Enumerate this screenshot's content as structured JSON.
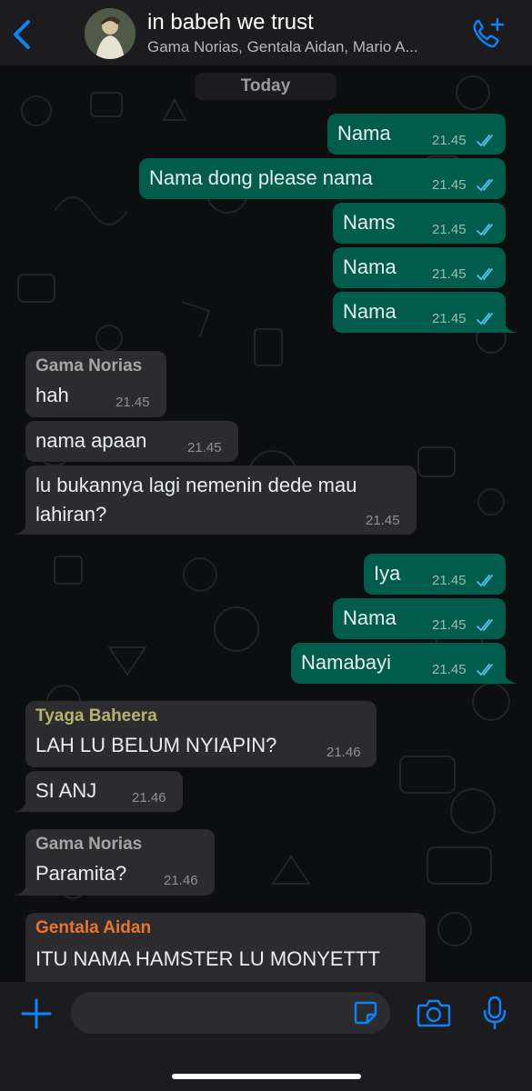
{
  "header": {
    "back_icon": "chevron-left-icon",
    "title": "in babeh we trust",
    "subtitle": "Gama Norias, Gentala Aidan, Mario A...",
    "call_icon": "add-call-icon",
    "accent": "#0a84ff"
  },
  "chat": {
    "date_label": "Today",
    "outgoing_color": "#005c4b",
    "incoming_color": "#2c2c2e",
    "read_tick_color": "#53bdeb",
    "messages": [
      {
        "dir": "out",
        "text": "Nama",
        "time": "21.45",
        "status": "read"
      },
      {
        "dir": "out",
        "text": "Nama dong please nama",
        "time": "21.45",
        "status": "read"
      },
      {
        "dir": "out",
        "text": "Nams",
        "time": "21.45",
        "status": "read"
      },
      {
        "dir": "out",
        "text": "Nama",
        "time": "21.45",
        "status": "read"
      },
      {
        "dir": "out",
        "text": "Nama",
        "time": "21.45",
        "status": "read"
      },
      {
        "dir": "in",
        "sender": "Gama Norias",
        "sender_color": "#a6a6a6",
        "text": "hah",
        "time": "21.45"
      },
      {
        "dir": "in",
        "text": "nama apaan",
        "time": "21.45"
      },
      {
        "dir": "in",
        "text": "lu bukannya lagi nemenin dede mau",
        "text2": "lahiran?",
        "time": "21.45"
      },
      {
        "dir": "out",
        "text": "Iya",
        "time": "21.45",
        "status": "read"
      },
      {
        "dir": "out",
        "text": "Nama",
        "time": "21.45",
        "status": "read"
      },
      {
        "dir": "out",
        "text": "Namabayi",
        "time": "21.45",
        "status": "read"
      },
      {
        "dir": "in",
        "sender": "Tyaga Baheera",
        "sender_color": "#b5b46a",
        "text": "LAH LU BELUM NYIAPIN?",
        "time": "21.46"
      },
      {
        "dir": "in",
        "text": "SI ANJ",
        "time": "21.46"
      },
      {
        "dir": "in",
        "sender": "Gama Norias",
        "sender_color": "#a6a6a6",
        "text": "Paramita?",
        "time": "21.46"
      },
      {
        "dir": "in",
        "sender": "Gentala Aidan",
        "sender_color": "#e8762d",
        "text": "ITU NAMA HAMSTER LU MONYETTT",
        "time": ""
      }
    ]
  },
  "composer": {
    "plus_icon": "plus-icon",
    "input_value": "",
    "input_placeholder": "",
    "sticker_icon": "sticker-icon",
    "camera_icon": "camera-icon",
    "mic_icon": "microphone-icon"
  }
}
